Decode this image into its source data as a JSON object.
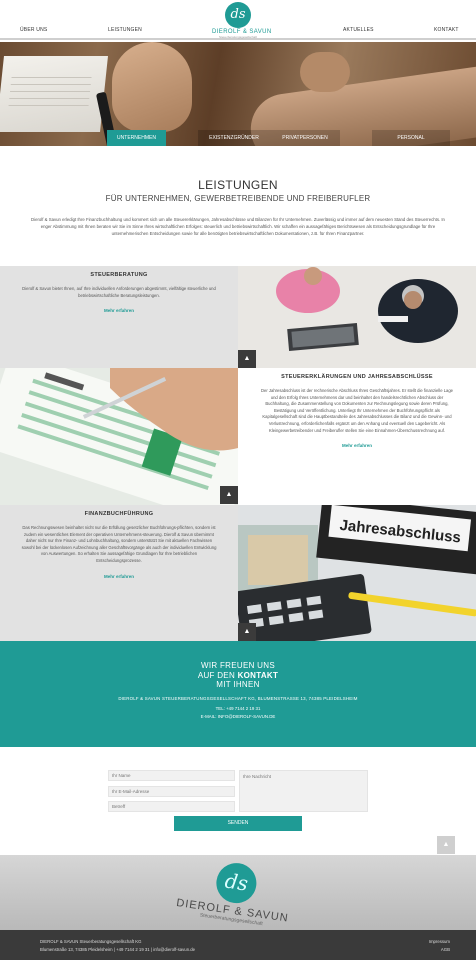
{
  "nav": {
    "items": [
      "ÜBER UNS",
      "LEISTUNGEN",
      "AKTUELLES",
      "KONTAKT"
    ],
    "logo_monogram": "ds",
    "logo_text": "DIEROLF & SAVUN",
    "logo_sub": "Steuerberatungsgesellschaft"
  },
  "hero": {
    "tabs": [
      "UNTERNEHMEN",
      "EXISTENZGRÜNDER",
      "PRIVATPERSONEN",
      "PERSONAL"
    ],
    "active_tab": "UNTERNEHMEN"
  },
  "intro": {
    "title": "LEISTUNGEN",
    "subtitle": "FÜR UNTERNEHMEN, GEWERBETREIBENDE UND FREIBERUFLER",
    "text": "Dierolf & Savun erledigt Ihre Finanzbuchhaltung und kommert sich um alle Steuererklärungen, Jahresabschlüsse und Bilanzen für Ihr Unternehmen. Zuverlässig und immer auf dem neuesten Stand des Steuerrechts. In enger Abstimmung mit Ihnen beraten wir Sie im Sinne Ihres wirtschaftlichen Erfolges: steuerlich und betriebswirtschaftlich. Wir schaffen ein aussagefähiges Berichtswesen als Entscheidungsgrundlage für Ihre unternehmerischen Entscheidungen sowie für alle benötigten betriebswirtschaftlichen Dokumentationen, z.B. für Ihren Finanzpartner."
  },
  "services": [
    {
      "title": "STEUERBERATUNG",
      "text": "Dierolf & Savun bietet Ihnen, auf Ihre individuellen Anforderungen abgestimmt, vielfältige steuerliche und betriebswirtschaftliche Beratungsleistungen.",
      "more": "Mehr erfahren"
    },
    {
      "title": "STEUERERKLÄRUNGEN UND JAHRESABSCHLÜSSE",
      "text": "Der Jahresabschluss ist der rechnerische Abschluss Ihres Geschäftsjahres. Er stellt die finanzielle Lage und den Erfolg Ihres Unternehmens dar und beinhaltet den handelsrechtlichen Abschluss der Buchhaltung, die Zusammenstellung von Dokumenten zur Rechnungslegung sowie deren Prüfung, Bestätigung und Veröffentlichung. Unterliegt Ihr Unternehmen der Buchführungspflicht als Kapitalgesellschaft sind die Hauptbestandteile des Jahresabschlusses die Bilanz und die Gewinn- und Verlustrechnung, erforderlichenfalls ergänzt um den Anhang und eventuell den Lagebericht. Als Kleingewerbetreibender und Freiberufler stellen Sie eine Einnahmen-Überschussrechnung auf.",
      "more": "Mehr erfahren"
    },
    {
      "title": "FINANZBUCHFÜHRUNG",
      "text": "Das Rechnungswesen beinhaltet nicht nur die Erfüllung gesetzlicher Buchführungs-pflichten, sondern ist zudem ein wesentliches Element der operativen Unternehmens-steuerung. Dierolf & Savun übernimmt daher nicht nur Ihre Finanz- und Lohnbuchhaltung, sondern unterstützt Sie mit aktuellen Fachwissen sowohl bei der lückenlosen Aufzeichnung aller Geschäftsvorgänge als auch der individuellen Entwicklung von Auswertungen. So erhalten Sie aussagefähige Grundlagen für Ihre betrieblichen Entscheidungsprozesse.",
      "more": "Mehr erfahren"
    }
  ],
  "jahres_label": "Jahresabschluss",
  "contact": {
    "line1": "WIR FREUEN UNS",
    "line2_pre": "AUF DEN ",
    "line2_bold": "KONTAKT",
    "line3": "MIT IHNEN",
    "address": "DIEROLF & SAVUN STEUERBERATUNGSGESELLSCHAFT KG, BLUMENSTRASSE 13, 74385 PLEIDELSHEIM",
    "tel": "TEL: +49 7144 2 19 31",
    "mail": "E-MAIL: INFO@DIEROLF-SAVUN.DE"
  },
  "form": {
    "name_placeholder": "Ihr Name",
    "email_placeholder": "Ihr E-Mail-Adresse",
    "subject_placeholder": "Betreff",
    "message_placeholder": "Ihre Nachricht",
    "send_label": "SENDEN"
  },
  "band": {
    "monogram": "ds",
    "name": "DIEROLF & SAVUN",
    "sub": "Steuerberatungsgesellschaft"
  },
  "footer": {
    "company": "DIEROLF & SAVUN Steuerberatungsgesellschaft KG",
    "contact": "Blumenstraße 13, 74385 Pleidelsheim | +49 7144 2 19 31 | info@dierolf-savun.de",
    "impressum": "Impressum",
    "agb": "AGB"
  },
  "icons": {
    "scroll_up": "chevron-up-icon"
  },
  "colors": {
    "accent": "#1f9b95",
    "footer": "#3a3a3a",
    "panel": "#e2e2e2"
  }
}
